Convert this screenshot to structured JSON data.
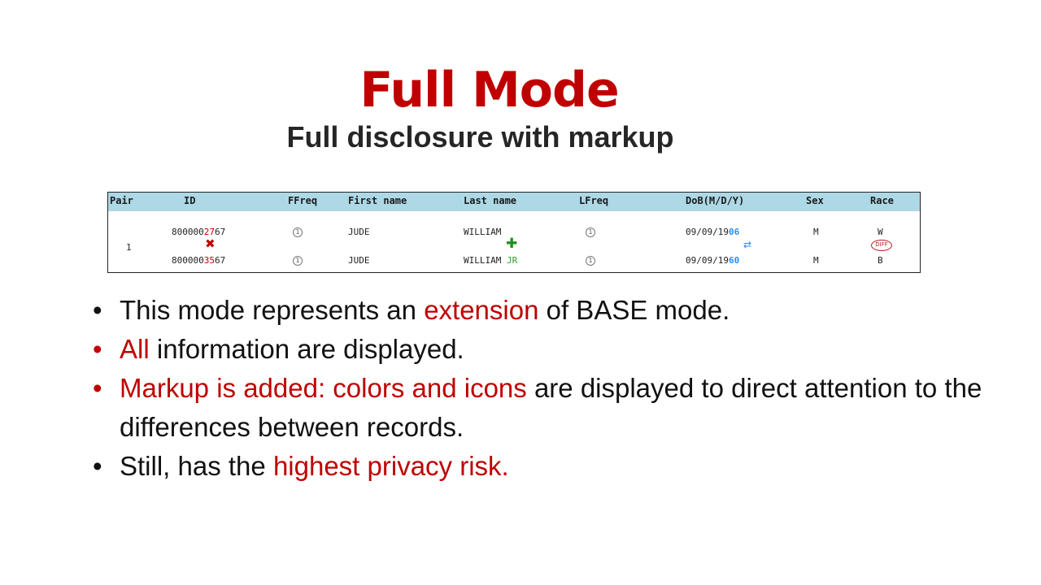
{
  "slide": {
    "title": "Full Mode",
    "subtitle": "Full disclosure with markup"
  },
  "table": {
    "headers": {
      "pair": "Pair",
      "id": "ID",
      "ffreq": "FFreq",
      "first_name": "First name",
      "last_name": "Last name",
      "lfreq": "LFreq",
      "dob": "DoB(M/D/Y)",
      "sex": "Sex",
      "race": "Race"
    },
    "pair_number": "1",
    "row1": {
      "id_prefix": "800000",
      "id_diff": "27",
      "id_suffix": "67",
      "ffreq": "1",
      "first_name": "JUDE",
      "last_name": "WILLIAM",
      "lfreq": "1",
      "dob_prefix": "09/09/19",
      "dob_diff": "06",
      "sex": "M",
      "race": "W"
    },
    "row2": {
      "id_prefix": "800000",
      "id_diff": "35",
      "id_suffix": "67",
      "ffreq": "1",
      "first_name": "JUDE",
      "last_name": "WILLIAM",
      "last_name_extra": "JR",
      "lfreq": "1",
      "dob_prefix": "09/09/19",
      "dob_diff": "60",
      "sex": "M",
      "race": "B"
    },
    "markers": {
      "id_marker": "✖",
      "last_name_marker": "✚",
      "dob_marker": "⇄",
      "race_marker": "DIFF"
    }
  },
  "bullets": {
    "b1_pre": "This mode represents an ",
    "b1_red": "extension",
    "b1_post": " of BASE mode.",
    "b2_red": "All",
    "b2_post": " information are displayed.",
    "b3_red": "Markup is added: colors and icons",
    "b3_post": " are displayed to direct attention to the differences between records.",
    "b4_pre": "Still, has the ",
    "b4_red": "highest privacy risk."
  },
  "colors": {
    "accent_red": "#c00000",
    "header_blue": "#add8e6",
    "diff_blue": "#1e90ff",
    "add_green": "#2e9e2e"
  }
}
